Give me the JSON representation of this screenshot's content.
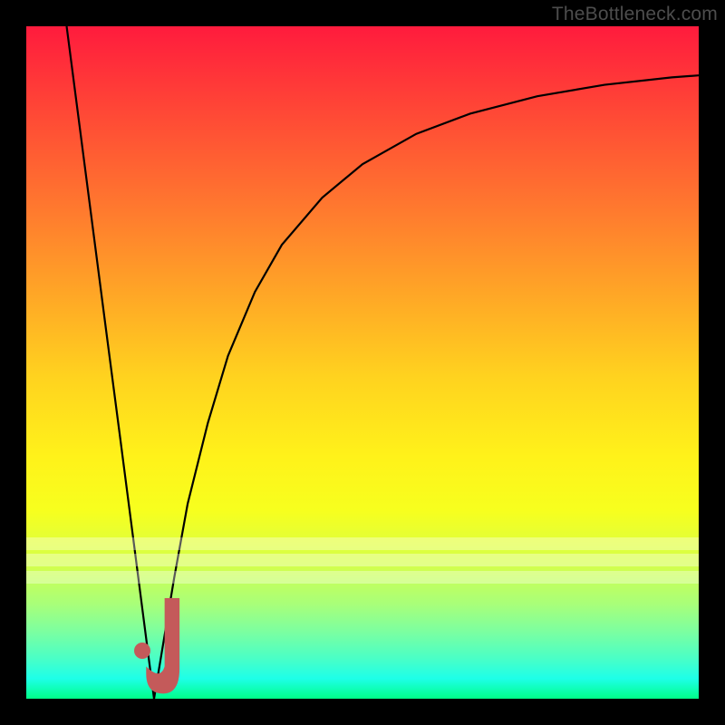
{
  "watermark": {
    "text": "TheBottleneck.com"
  },
  "colors": {
    "frame": "#000000",
    "curve": "#000000",
    "marker": "#c45a5a",
    "gradient_top": "#ff1b3d",
    "gradient_bottom": "#00ff88"
  },
  "chart_data": {
    "type": "line",
    "title": "",
    "xlabel": "",
    "ylabel": "",
    "xlim": [
      0,
      100
    ],
    "ylim": [
      0,
      100
    ],
    "series": [
      {
        "name": "curve-left",
        "x": [
          6.0,
          8.0,
          10.0,
          12.0,
          14.0,
          16.0,
          17.5,
          18.5,
          19.0
        ],
        "values": [
          100.0,
          84.6,
          69.2,
          53.8,
          38.5,
          23.1,
          11.5,
          3.8,
          0.0
        ]
      },
      {
        "name": "curve-right",
        "x": [
          19.0,
          20.0,
          22.0,
          24.0,
          27.0,
          30.0,
          34.0,
          38.0,
          44.0,
          50.0,
          58.0,
          66.0,
          76.0,
          86.0,
          96.0,
          100.0
        ],
        "values": [
          0.0,
          6.0,
          18.0,
          29.0,
          41.0,
          51.0,
          60.5,
          67.5,
          74.5,
          79.5,
          84.0,
          87.0,
          89.6,
          91.3,
          92.4,
          92.7
        ]
      }
    ],
    "marker": {
      "name": "current-point",
      "x": 17.3,
      "y": 7.1
    },
    "tick_overlay": {
      "x": 19.3,
      "y": 2.0,
      "width_pct": 3.0,
      "height_pct": 13.0
    },
    "pale_bands_y": [
      24.0,
      21.5,
      19.0
    ]
  }
}
